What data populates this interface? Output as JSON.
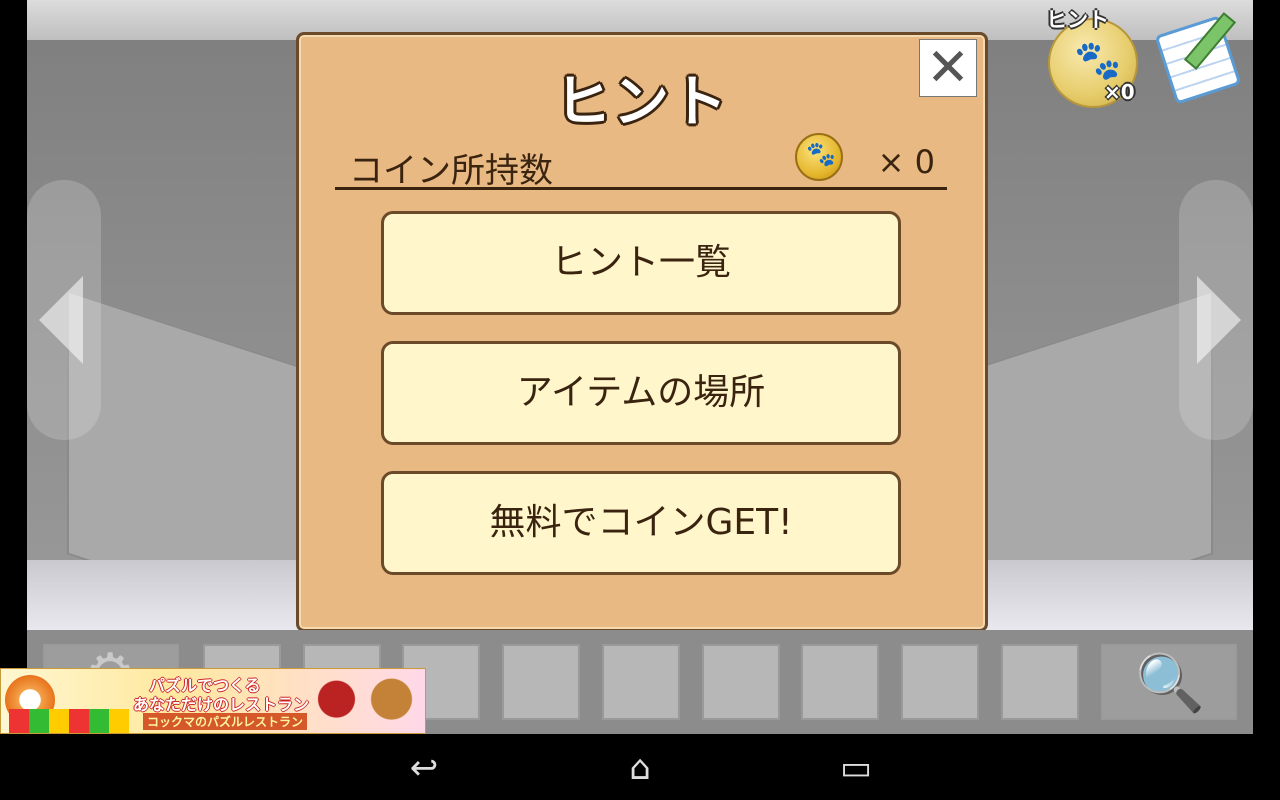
{
  "hud": {
    "hint_label": "ヒント",
    "hint_count": "×0"
  },
  "dialog": {
    "title": "ヒント",
    "close_symbol": "✕",
    "coin_label": "コイン所持数",
    "coin_count": "× 0",
    "buttons": [
      {
        "label": "ヒント一覧"
      },
      {
        "label": "アイテムの場所"
      },
      {
        "label": "無料でコインGET!"
      }
    ]
  },
  "ad": {
    "line1": "パズルでつくる",
    "line2": "あなただけのレストラン",
    "line3": "コックマのパズルレストラン"
  },
  "icons": {
    "gear": "⚙",
    "zoom": "🔍",
    "paw": "🐾",
    "back": "↩",
    "home": "⌂",
    "recents": "▭"
  },
  "colors": {
    "dialog_bg": "#e8b983",
    "button_bg": "#fff6cc",
    "text_dark": "#3a2410"
  }
}
